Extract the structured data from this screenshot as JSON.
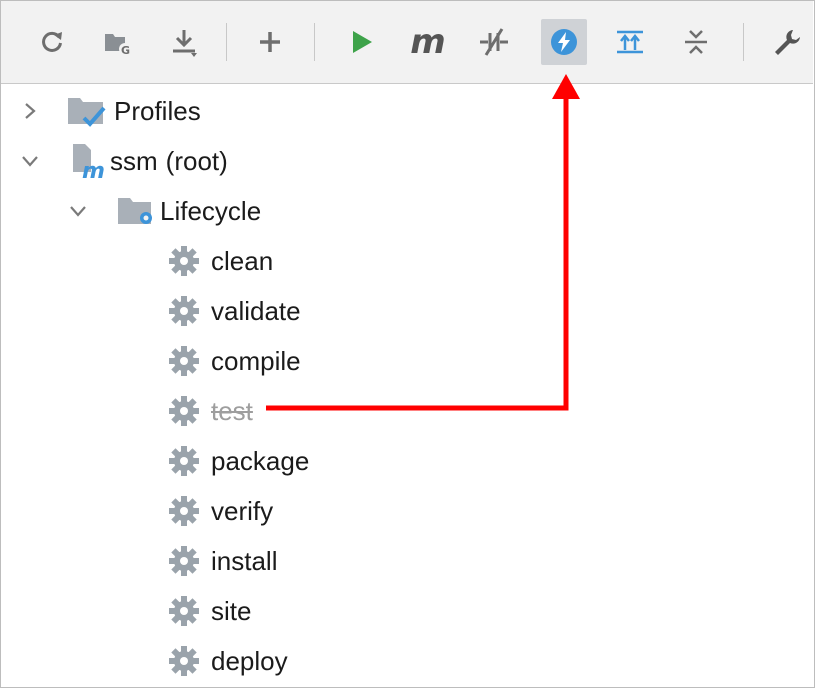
{
  "toolbar": {
    "buttons": [
      {
        "icon": "refresh-icon"
      },
      {
        "icon": "generate-sources-icon"
      },
      {
        "icon": "download-icon"
      },
      {
        "icon": "add-icon"
      },
      {
        "icon": "run-icon"
      },
      {
        "icon": "execute-maven-goal-icon",
        "label": "m"
      },
      {
        "icon": "toggle-offline-icon"
      },
      {
        "icon": "skip-tests-icon",
        "active": true
      },
      {
        "icon": "show-dependencies-icon"
      },
      {
        "icon": "collapse-all-icon"
      },
      {
        "icon": "settings-wrench-icon"
      }
    ]
  },
  "tree": {
    "profiles": {
      "label": "Profiles",
      "icon": "profiles-folder-icon"
    },
    "root": {
      "name": "ssm",
      "suffix": "(root)",
      "icon": "maven-module-icon"
    },
    "lifecycle": {
      "label": "Lifecycle",
      "icon": "lifecycle-folder-icon"
    },
    "goals": [
      {
        "label": "clean",
        "disabled": false
      },
      {
        "label": "validate",
        "disabled": false
      },
      {
        "label": "compile",
        "disabled": false
      },
      {
        "label": "test",
        "disabled": true
      },
      {
        "label": "package",
        "disabled": false
      },
      {
        "label": "verify",
        "disabled": false
      },
      {
        "label": "install",
        "disabled": false
      },
      {
        "label": "site",
        "disabled": false
      },
      {
        "label": "deploy",
        "disabled": false
      }
    ]
  },
  "colors": {
    "toolbar_bg": "#f2f2f2",
    "active_button_bg": "#cfd2d6",
    "run_green": "#3ea34a",
    "accent_blue": "#3d94d9",
    "annotation_red": "#ff0000",
    "gear_gray": "#9aa3ab"
  }
}
